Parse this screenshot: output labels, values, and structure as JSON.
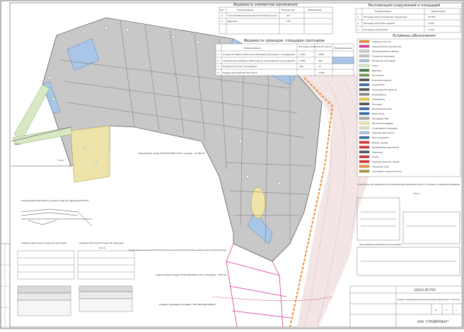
{
  "drawing": {
    "title_spec": "Ведомость элементов озеленения",
    "title_areas": "Экспликация сооружений и площадей",
    "title_roads": "Ведомость проездов, площадок,тротуаров",
    "title_legend": "Условные обозначения",
    "title_cross": "Понижение бортового камня в местах движения МГН",
    "title_pave1": "Асфальтобетонное покрытие тротуаров",
    "title_pave2": "Асфальтобетонное покрытие проездов",
    "title_pave2_type": "Тип 4",
    "title_right_note": "Строительство пересечения (примыкания) проездов дороги и съезда на землепользование",
    "note_right_small": "Организация проездов участка работ",
    "cadastre_1": "кадастровый номер 78:36:0013601:1573, площадь - 23 360 м2",
    "cadastre_2": "кадастровый номер 78:36:0013601:1574, площадь - 760 м2",
    "cadastre_3": "кадастровый номер 78:36:0013607",
    "note_text": "Примечание. Временные бортовые камни БР 100.30.15 На части прилегающих участков к обустройству будут демонтированы к свободной застройке с благоустройством территорий",
    "column_headers": {
      "number": "Поз.",
      "name": "Наименование",
      "quantity": "Количество",
      "note": "Примечание",
      "area": "Площадь покрытия м2 (кв.м)"
    },
    "roads_rows": [
      {
        "n": "1",
        "name": "Покрытие асфальтобетонное проездов (проездов) с площадками",
        "v1": "7 620",
        "v2": "1800"
      },
      {
        "n": "2",
        "name": "Покрытие асфальтобетонное тротуаров (тротуаров)",
        "v1": "2 680",
        "v2": "460"
      },
      {
        "n": "3",
        "name": "Покрытие из плит тротуарных",
        "v1": "340",
        "v2": "12"
      },
      {
        "n": "4",
        "name": "Камень бортовой БР 100.30.15",
        "v1": "",
        "v2": "2 000"
      }
    ],
    "spec_rows": [
      {
        "n": "1",
        "name": "Газон обыкновенный (посев трав по растительному грунту)",
        "v1": "4.5"
      },
      {
        "n": "2",
        "name": "Деревья",
        "v1": "120"
      }
    ],
    "areas_rows": [
      {
        "n": "1",
        "name": "Площадь благоустройства территории",
        "v": "23 360"
      },
      {
        "n": "2",
        "name": "Площадь застройки здания",
        "v": "5 540"
      },
      {
        "n": "3",
        "name": "Площадь озеленения",
        "v": "4 120"
      }
    ],
    "legend_items": [
      "Граница участка",
      "Граница благоустройства",
      "Проектируемое здание",
      "Покрытие проездов",
      "Покрытие тротуаров",
      "Газон",
      "Деревья",
      "Кустарник",
      "Бортовой камень",
      "Съезд МГН",
      "Пешеходный переход",
      "Ограждение",
      "Освещение",
      "Колодцы",
      "Дождеприемники",
      "Водоотвод",
      "Площадка ТБО",
      "Детская площадка",
      "Спортивная площадка",
      "Парковочные места",
      "Места для МГН",
      "Въезд / выезд",
      "Направление движения",
      "Разметка",
      "Знаки",
      "Граница красных линий",
      "Охранная зона",
      "Санитарно-защитная зона"
    ],
    "stamp": {
      "code": "120/22-ЭП-ПЗУ",
      "sheet_title": "Схема планировочной организации земельного участка",
      "stage": "П",
      "sheet": "1",
      "sheets": "1",
      "org": "ООО \"СТРОЙПРОЕКТ\""
    },
    "tip_labels": [
      "Тип 1",
      "Тип 2",
      "Тип 3",
      "Тип 4"
    ]
  }
}
